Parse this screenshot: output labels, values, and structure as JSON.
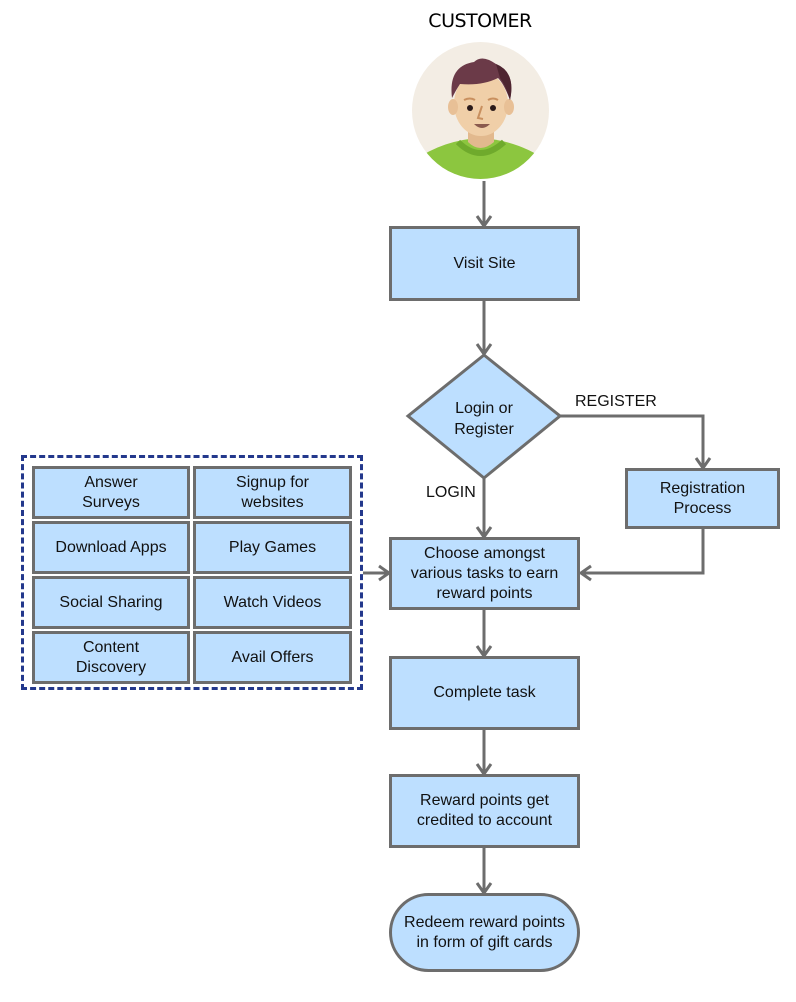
{
  "title": "CUSTOMER",
  "avatar": {
    "icon": "customer-avatar-icon",
    "colors": {
      "background": "#f3ede4",
      "hair": "#6b3a48",
      "skin": "#f0cfa8",
      "shirt": "#8cc63f"
    }
  },
  "nodes": {
    "visit_site": "Visit Site",
    "decision": {
      "line1": "Login or",
      "line2": "Register"
    },
    "registration": "Registration Process",
    "choose_tasks": "Choose amongst various tasks to earn reward points",
    "complete_task": "Complete task",
    "credited": "Reward points get credited to account",
    "redeem": "Redeem reward points in form of gift cards"
  },
  "edge_labels": {
    "register": "REGISTER",
    "login": "LOGIN"
  },
  "tasks": [
    "Answer Surveys",
    "Signup for websites",
    "Download Apps",
    "Play Games",
    "Social Sharing",
    "Watch Videos",
    "Content Discovery",
    "Avail Offers"
  ],
  "colors": {
    "node_fill": "#bddfff",
    "node_border": "#6d6d6d",
    "connector": "#6d6d6d",
    "group_border": "#23388c"
  }
}
